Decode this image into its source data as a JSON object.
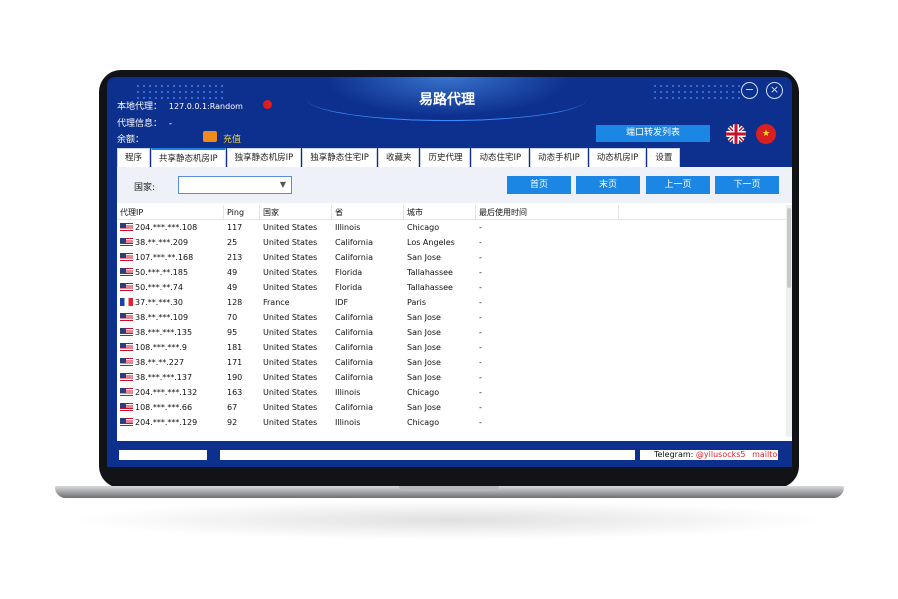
{
  "app": {
    "title": "易路代理"
  },
  "window": {
    "minimize_glyph": "−",
    "close_glyph": "×"
  },
  "info": {
    "local_proxy_label": "本地代理：",
    "local_proxy_value": "127.0.0.1:Random",
    "proxy_info_label": "代理信息：",
    "proxy_info_value": "-",
    "balance_label": "余额：",
    "recharge_label": "充值"
  },
  "header": {
    "forward_list_button": "端口转发列表"
  },
  "tabs": [
    {
      "label": "程序"
    },
    {
      "label": "共享静态机房IP",
      "active": true
    },
    {
      "label": "独享静态机房IP"
    },
    {
      "label": "独享静态住宅IP"
    },
    {
      "label": "收藏夹"
    },
    {
      "label": "历史代理"
    },
    {
      "label": "动态住宅IP"
    },
    {
      "label": "动态手机IP"
    },
    {
      "label": "动态机房IP"
    },
    {
      "label": "设置"
    }
  ],
  "filter": {
    "country_label": "国家:",
    "country_value": "",
    "buttons": {
      "first": "首页",
      "last": "末页",
      "prev": "上一页",
      "next": "下一页"
    }
  },
  "table": {
    "columns": [
      "代理IP",
      "Ping",
      "国家",
      "省",
      "城市",
      "最后使用时间"
    ],
    "rows": [
      {
        "flag": "us",
        "ip": "204.***.***.108",
        "ping": "117",
        "country": "United States",
        "province": "Illinois",
        "city": "Chicago",
        "last_used": "-"
      },
      {
        "flag": "us",
        "ip": "38.**.***.209",
        "ping": "25",
        "country": "United States",
        "province": "California",
        "city": "Los Angeles",
        "last_used": "-"
      },
      {
        "flag": "us",
        "ip": "107.***.**.168",
        "ping": "213",
        "country": "United States",
        "province": "California",
        "city": "San Jose",
        "last_used": "-"
      },
      {
        "flag": "us",
        "ip": "50.***.**.185",
        "ping": "49",
        "country": "United States",
        "province": "Florida",
        "city": "Tallahassee",
        "last_used": "-"
      },
      {
        "flag": "us",
        "ip": "50.***.**.74",
        "ping": "49",
        "country": "United States",
        "province": "Florida",
        "city": "Tallahassee",
        "last_used": "-"
      },
      {
        "flag": "fr",
        "ip": "37.**.***.30",
        "ping": "128",
        "country": "France",
        "province": "IDF",
        "city": "Paris",
        "last_used": "-"
      },
      {
        "flag": "us",
        "ip": "38.**.***.109",
        "ping": "70",
        "country": "United States",
        "province": "California",
        "city": "San Jose",
        "last_used": "-"
      },
      {
        "flag": "us",
        "ip": "38.***.***.135",
        "ping": "95",
        "country": "United States",
        "province": "California",
        "city": "San Jose",
        "last_used": "-"
      },
      {
        "flag": "us",
        "ip": "108.***.***.9",
        "ping": "181",
        "country": "United States",
        "province": "California",
        "city": "San Jose",
        "last_used": "-"
      },
      {
        "flag": "us",
        "ip": "38.**.**.227",
        "ping": "171",
        "country": "United States",
        "province": "California",
        "city": "San Jose",
        "last_used": "-"
      },
      {
        "flag": "us",
        "ip": "38.***.***.137",
        "ping": "190",
        "country": "United States",
        "province": "California",
        "city": "San Jose",
        "last_used": "-"
      },
      {
        "flag": "us",
        "ip": "204.***.***.132",
        "ping": "163",
        "country": "United States",
        "province": "Illinois",
        "city": "Chicago",
        "last_used": "-"
      },
      {
        "flag": "us",
        "ip": "108.***.***.66",
        "ping": "67",
        "country": "United States",
        "province": "California",
        "city": "San Jose",
        "last_used": "-"
      },
      {
        "flag": "us",
        "ip": "204.***.***.129",
        "ping": "92",
        "country": "United States",
        "province": "Illinois",
        "city": "Chicago",
        "last_used": "-"
      }
    ]
  },
  "status": {
    "telegram_label": "Telegram:",
    "telegram_handle": "@yilusocks5",
    "mailto": "mailto"
  },
  "colors": {
    "accent": "#1b86e3",
    "chrome": "#0d2f8e",
    "danger": "#e21b1b"
  },
  "icons": [
    "minimize-icon",
    "close-icon",
    "status-dot-icon",
    "recharge-icon",
    "uk-flag-icon",
    "china-flag-icon",
    "dropdown-caret-icon",
    "us-flag-icon",
    "france-flag-icon"
  ]
}
